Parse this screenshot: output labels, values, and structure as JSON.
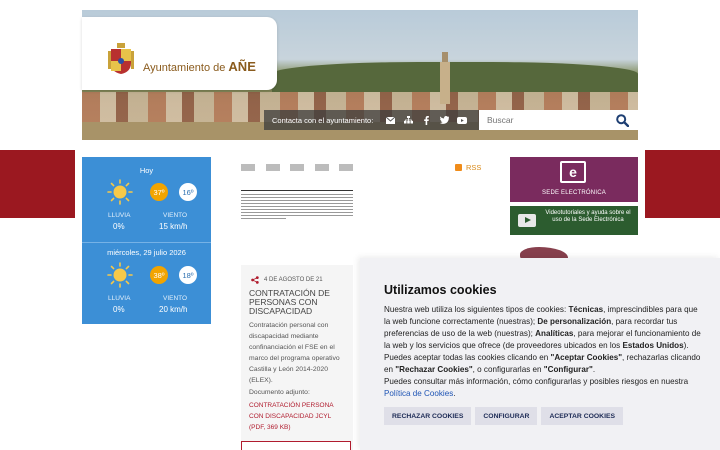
{
  "header": {
    "logo_text": "Ayuntamiento de ",
    "logo_town": "AÑE",
    "contact_label": "Contacta con el ayuntamiento:",
    "contact_icons": [
      "envelope-icon",
      "sitemap-icon",
      "facebook-icon",
      "twitter-icon",
      "youtube-icon"
    ],
    "search_placeholder": "Buscar"
  },
  "weather": {
    "today": {
      "title": "Hoy",
      "max": "37º",
      "min": "16º",
      "rain_label": "LLUVIA",
      "rain_value": "0%",
      "wind_label": "VIENTO",
      "wind_value": "15 km/h"
    },
    "tomorrow": {
      "title": "miércoles, 29 julio 2026",
      "max": "38º",
      "min": "18º",
      "rain_label": "LLUVIA",
      "rain_value": "0%",
      "wind_label": "VIENTO",
      "wind_value": "20 km/h"
    }
  },
  "rss": {
    "label": "RSS"
  },
  "sede": {
    "label": "SEDE ELECTRÓNICA",
    "icon_letter": "e"
  },
  "video": {
    "label": "Videotutoriales y ayuda sobre el uso de la Sede Electrónica"
  },
  "news": {
    "date": "4 DE AGOSTO DE 21",
    "title": "CONTRATACIÓN DE PERSONAS CON DISCAPACIDAD",
    "body": "Contratación personal con discapacidad mediante confinanciación el FSE en el marco del programa operativo Castilla y León 2014-2020 (ELEX).",
    "attachment_label": "Documento adjunto:",
    "attachment_link": "CONTRATACIÓN PERSONA CON DISCAPACIDAD JCYL (PDF, 369 KB)"
  },
  "cookies": {
    "title": "Utilizamos cookies",
    "p1_a": "Nuestra web utiliza los siguientes tipos de cookies: ",
    "p1_b": "Técnicas",
    "p1_c": ", imprescindibles para que la web funcione correctamente (nuestras); ",
    "p1_d": "De personalización",
    "p1_e": ", para recordar tus preferencias de uso de la web (nuestras); ",
    "p1_f": "Analíticas",
    "p1_g": ", para mejorar el funcionamiento de la web y los servicios que ofrece (de proveedores ubicados en los ",
    "p1_h": "Estados Unidos",
    "p1_i": ").",
    "p2_a": "Puedes aceptar todas las cookies clicando en ",
    "p2_b": "\"Aceptar Cookies\"",
    "p2_c": ", rechazarlas clicando en ",
    "p2_d": "\"Rechazar Cookies\"",
    "p2_e": ", o configurarlas en ",
    "p2_f": "\"Configurar\"",
    "p2_g": ".",
    "p3_a": "Puedes consultar más información, cómo configurarlas y posibles riesgos en nuestra ",
    "p3_link": "Política de Cookies",
    "p3_b": ".",
    "btn_reject": "RECHAZAR COOKIES",
    "btn_config": "CONFIGURAR",
    "btn_accept": "ACEPTAR COOKIES"
  },
  "colors": {
    "brand_red": "#9b1820",
    "weather_blue": "#3c8fd6",
    "sede_purple": "#7a2b5e",
    "video_green": "#2c5c2f"
  }
}
